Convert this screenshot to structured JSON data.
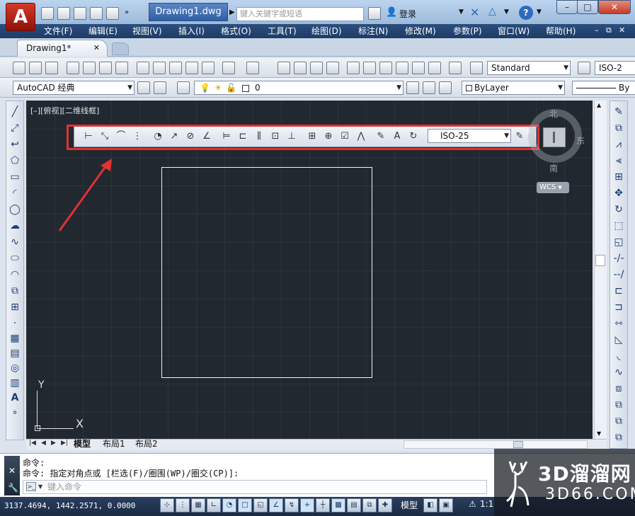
{
  "title_bar": {
    "app_logo": "A",
    "document_title": "Drawing1.dwg",
    "search_placeholder": "键入关键字或短语",
    "login_label": "登录",
    "help_label": "?",
    "minimize": "–",
    "restore": "□",
    "close": "✕"
  },
  "menu": [
    "文件(F)",
    "编辑(E)",
    "视图(V)",
    "插入(I)",
    "格式(O)",
    "工具(T)",
    "绘图(D)",
    "标注(N)",
    "修改(M)",
    "参数(P)",
    "窗口(W)",
    "帮助(H)"
  ],
  "file_tab": {
    "label": "Drawing1*"
  },
  "toolbar_standard": {
    "text_style": "Standard",
    "dim_style": "ISO-2"
  },
  "toolbar_layers": {
    "workspace": "AutoCAD 经典",
    "layer": "0",
    "color": "ByLayer",
    "linetype": "By"
  },
  "viewport": {
    "label": "[–][俯视][二维线框]"
  },
  "dim_toolbar": {
    "dim_style": "ISO-25",
    "close": "x"
  },
  "viewcube": {
    "north": "北",
    "east": "东",
    "south": "南",
    "wcs": "WCS"
  },
  "ucs": {
    "x": "X",
    "y": "Y"
  },
  "layout_tabs": [
    "模型",
    "布局1",
    "布局2"
  ],
  "command": {
    "line1": "命令:",
    "line2": "命令: 指定对角点或 [栏选(F)/圈围(WP)/圈交(CP)]:",
    "input_placeholder": "键入命令"
  },
  "status_bar": {
    "coordinates": "3137.4694, 1442.2571, 0.0000",
    "model": "模型",
    "scale": "1:1"
  },
  "watermark": {
    "brand": "3D溜溜网",
    "domain": "3D66.COM"
  },
  "colors": {
    "canvas": "#212830",
    "highlight": "#e23131",
    "titlebar": "#9cb9db",
    "status": "#1a2a43"
  }
}
